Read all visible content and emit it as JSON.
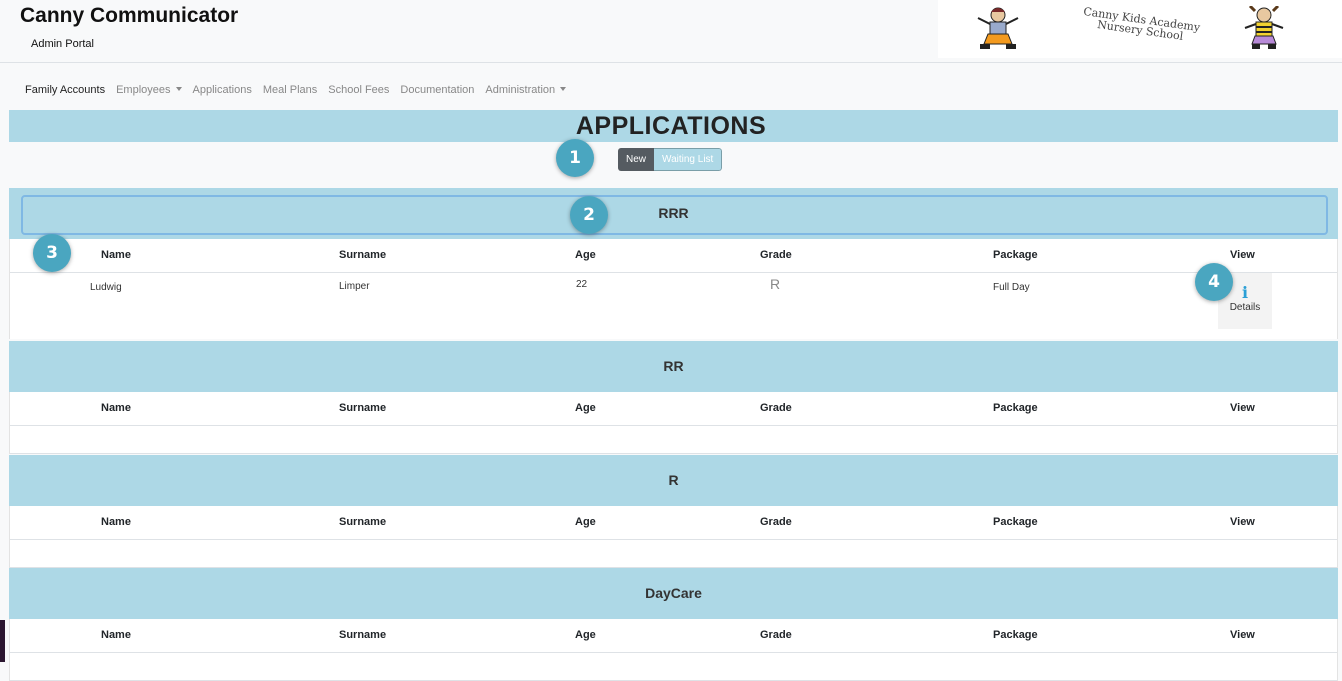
{
  "header": {
    "title": "Canny Communicator",
    "subtitle": "Admin Portal",
    "logo_text": "Canny Kids Academy Nursery School"
  },
  "nav": {
    "items": [
      {
        "label": "Family Accounts",
        "dropdown": false,
        "active": true
      },
      {
        "label": "Employees",
        "dropdown": true,
        "active": false
      },
      {
        "label": "Applications",
        "dropdown": false,
        "active": false
      },
      {
        "label": "Meal Plans",
        "dropdown": false,
        "active": false
      },
      {
        "label": "School Fees",
        "dropdown": false,
        "active": false
      },
      {
        "label": "Documentation",
        "dropdown": false,
        "active": false
      },
      {
        "label": "Administration",
        "dropdown": true,
        "active": false
      }
    ]
  },
  "page": {
    "title": "APPLICATIONS"
  },
  "toggle": {
    "new_label": "New",
    "waiting_label": "Waiting List"
  },
  "markers": [
    "1",
    "2",
    "3",
    "4"
  ],
  "columns": [
    "Name",
    "Surname",
    "Age",
    "Grade",
    "Package",
    "View"
  ],
  "sections": [
    {
      "title": "RRR",
      "rows": [
        {
          "name": "Ludwig",
          "surname": "Limper",
          "age": "22",
          "grade": "R",
          "package": "Full Day",
          "view_label": "Details",
          "view_icon": "info-icon"
        }
      ]
    },
    {
      "title": "RR",
      "rows": []
    },
    {
      "title": "R",
      "rows": []
    },
    {
      "title": "DayCare",
      "rows": []
    }
  ],
  "colors": {
    "band": "#add8e6",
    "marker": "#4aa6c0",
    "toggle_active": "#555b61",
    "info_icon": "#2a9fd6"
  }
}
